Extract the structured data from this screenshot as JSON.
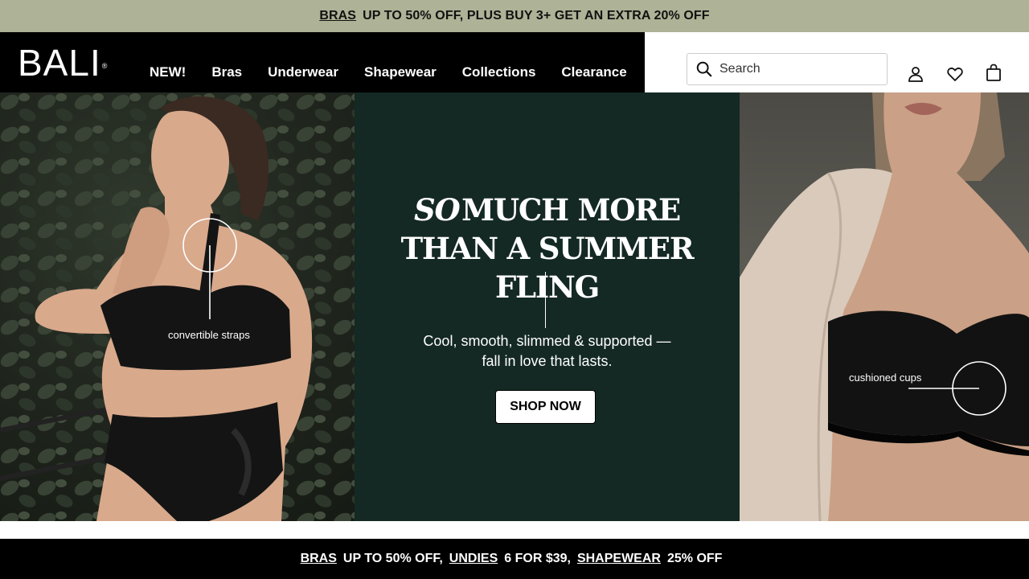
{
  "promo_top": {
    "link": "BRAS",
    "text": "UP TO 50% OFF, PLUS BUY 3+ GET AN EXTRA 20% OFF"
  },
  "header": {
    "logo": "BALI",
    "logo_mark": "®",
    "nav": [
      "NEW!",
      "Bras",
      "Underwear",
      "Shapewear",
      "Collections",
      "Clearance"
    ],
    "search_placeholder": "Search",
    "icons": [
      "account-icon",
      "wishlist-heart-icon",
      "shopping-bag-icon"
    ]
  },
  "hero": {
    "headline_italic": "SO",
    "headline_line1": "MUCH MORE",
    "headline_line2": "THAN A SUMMER FLING",
    "subtext_line1": "Cool, smooth, slimmed & supported —",
    "subtext_line2": "fall in love that lasts.",
    "cta": "SHOP NOW",
    "callout_left": "convertible straps",
    "callout_right": "cushioned cups",
    "panel_color": "#142924"
  },
  "promo_bottom": {
    "items": [
      {
        "link": "BRAS",
        "text": "UP TO 50% OFF,"
      },
      {
        "link": "UNDIES",
        "text": "6 FOR $39,"
      },
      {
        "link": "SHAPEWEAR",
        "text": "25% OFF"
      }
    ]
  },
  "colors": {
    "promo_top_bg": "#aeb296",
    "header_bg": "#000000",
    "accent_dark_green": "#142924"
  }
}
